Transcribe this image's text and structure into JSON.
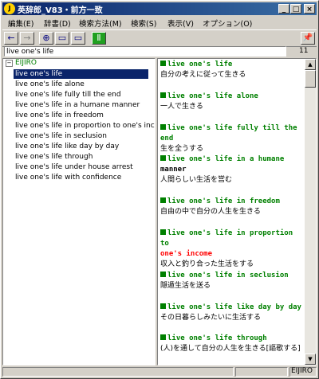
{
  "window": {
    "title": "英辞郎_V83・前方一致",
    "app_icon_text": "J",
    "accent": "#0a246a"
  },
  "menu": [
    {
      "label": "編集(E)"
    },
    {
      "label": "辞書(D)"
    },
    {
      "label": "検索方法(M)"
    },
    {
      "label": "検索(S)"
    },
    {
      "label": "表示(V)"
    },
    {
      "label": "オプション(O)"
    }
  ],
  "toolbar": {
    "back_icon": "←",
    "forward_icon": "→",
    "globe_icon": "⊕",
    "pane1_icon": "▭",
    "pane2_icon": "▭",
    "dict_icon": "Ⅱ",
    "pin_icon": "📌"
  },
  "search": {
    "value": "live one's life",
    "count": "11"
  },
  "tree": {
    "root_label": "EIJIRO",
    "root_toggle": "−",
    "items": [
      "live one's life",
      "live one's life alone",
      "live one's life fully till the end",
      "live one's life in a humane manner",
      "live one's life in freedom",
      "live one's life in proportion to one's income",
      "live one's life in seclusion",
      "live one's life like day by day",
      "live one's life through",
      "live one's life under house arrest",
      "live one's life with confidence"
    ]
  },
  "entries": [
    {
      "head": "live one's life",
      "def": "自分の考えに従って生きる"
    },
    {
      "head": "live one's life alone",
      "def": "一人で生きる"
    },
    {
      "head": "live one's life fully till the end",
      "def": "生を全うする"
    },
    {
      "head": "live one's life in a humane",
      "head2": "manner",
      "def": "人間らしい生活を営む"
    },
    {
      "head": "live one's life in freedom",
      "def": "自由の中で自分の人生を生きる"
    },
    {
      "head": "live one's life in proportion to",
      "head_red": "one's income",
      "def": "収入と釣り合った生活をする"
    },
    {
      "head": "live one's life in seclusion",
      "def": "隠遁生活を送る"
    },
    {
      "head": "live one's life like day by day",
      "def": "その日暮らしみたいに生活する"
    },
    {
      "head": "live one's life through",
      "def": "(人)を通して自分の人生を生きる[謳歌する]"
    }
  ],
  "status": {
    "dict_name": "EIJIRO"
  }
}
